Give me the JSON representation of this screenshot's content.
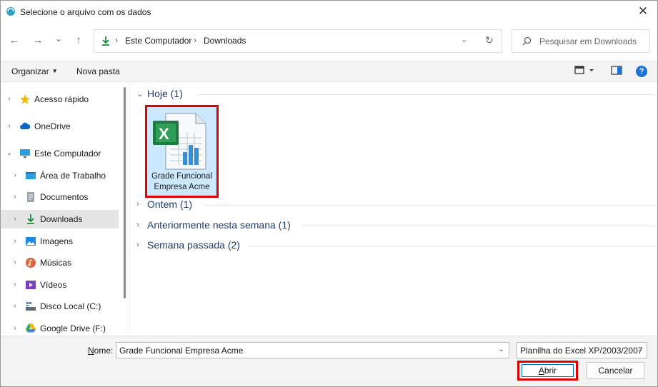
{
  "window": {
    "title": "Selecione o arquivo com os dados",
    "close": "✕"
  },
  "nav": {
    "back": "←",
    "forward": "→",
    "recent": "⌄",
    "up": "↑"
  },
  "address": {
    "segments": [
      "Este Computador",
      "Downloads"
    ],
    "separator": "›",
    "dropdown": "⌄",
    "refresh": "↻"
  },
  "search": {
    "placeholder": "Pesquisar em Downloads"
  },
  "commandbar": {
    "organize": "Organizar",
    "new_folder": "Nova pasta",
    "help": "?"
  },
  "sidebar": {
    "items": [
      {
        "label": "Acesso rápido",
        "icon": "star-icon"
      },
      {
        "label": "OneDrive",
        "icon": "cloud-icon"
      },
      {
        "label": "Este Computador",
        "icon": "monitor-icon"
      },
      {
        "label": "Área de Trabalho",
        "icon": "desktop-icon"
      },
      {
        "label": "Documentos",
        "icon": "document-icon"
      },
      {
        "label": "Downloads",
        "icon": "download-icon",
        "selected": true
      },
      {
        "label": "Imagens",
        "icon": "image-icon"
      },
      {
        "label": "Músicas",
        "icon": "music-icon"
      },
      {
        "label": "Vídeos",
        "icon": "video-icon"
      },
      {
        "label": "Disco Local (C:)",
        "icon": "drive-icon"
      },
      {
        "label": "Google Drive (F:)",
        "icon": "google-drive-icon"
      }
    ]
  },
  "groups": [
    {
      "label": "Hoje (1)",
      "expanded": true
    },
    {
      "label": "Ontem (1)",
      "expanded": false
    },
    {
      "label": "Anteriormente nesta semana (1)",
      "expanded": false
    },
    {
      "label": "Semana passada (2)",
      "expanded": false
    }
  ],
  "files": [
    {
      "name_line1": "Grade Funcional",
      "name_line2": "Empresa Acme",
      "icon": "excel-file-icon"
    }
  ],
  "bottom": {
    "name_label_hotkey": "N",
    "name_label_rest": "ome:",
    "file_name": "Grade Funcional Empresa Acme",
    "file_type": "Planilha do Excel XP/2003/2007",
    "open_hotkey": "A",
    "open_rest": "brir",
    "cancel": "Cancelar"
  },
  "colors": {
    "accent": "#0067c0",
    "highlight": "#e00000",
    "selection": "#cce8ff",
    "group_text": "#1e3b6e"
  }
}
